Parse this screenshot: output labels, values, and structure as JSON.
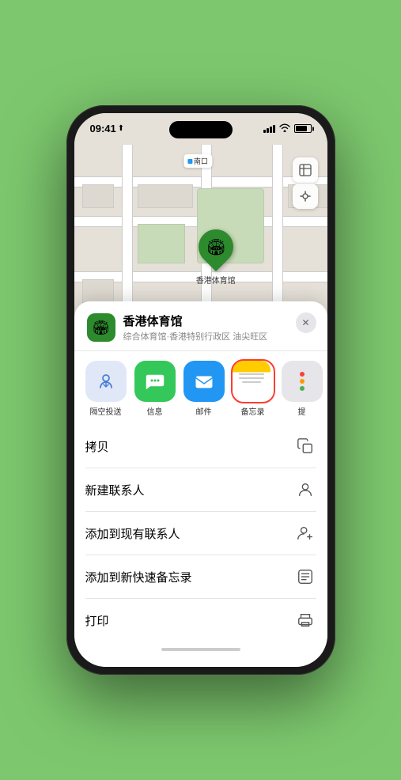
{
  "status": {
    "time": "09:41",
    "location_arrow": "▶"
  },
  "map": {
    "label_text": "南口",
    "controls": {
      "map_icon": "🗺",
      "location_icon": "⬆"
    },
    "pin": {
      "label": "香港体育馆",
      "emoji": "🏟"
    }
  },
  "location_card": {
    "name": "香港体育馆",
    "subtitle": "综合体育馆·香港特别行政区 油尖旺区",
    "close_label": "✕"
  },
  "share_items": [
    {
      "id": "airdrop",
      "label": "隔空投送",
      "type": "airdrop"
    },
    {
      "id": "messages",
      "label": "信息",
      "type": "messages"
    },
    {
      "id": "mail",
      "label": "邮件",
      "type": "mail"
    },
    {
      "id": "notes",
      "label": "备忘录",
      "type": "notes"
    },
    {
      "id": "more",
      "label": "提",
      "type": "more"
    }
  ],
  "actions": [
    {
      "id": "copy",
      "label": "拷贝",
      "icon": "copy"
    },
    {
      "id": "new-contact",
      "label": "新建联系人",
      "icon": "person-add"
    },
    {
      "id": "add-contact",
      "label": "添加到现有联系人",
      "icon": "person-plus"
    },
    {
      "id": "quick-note",
      "label": "添加到新快速备忘录",
      "icon": "note"
    },
    {
      "id": "print",
      "label": "打印",
      "icon": "printer"
    }
  ]
}
